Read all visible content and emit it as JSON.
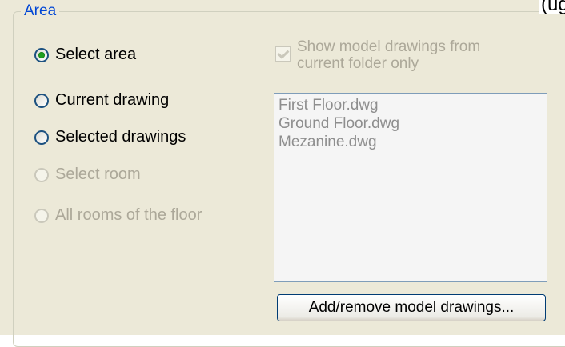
{
  "corner_text": "(ug",
  "area_group": {
    "legend": "Area",
    "radios": [
      {
        "label": "Select area",
        "checked": true,
        "enabled": true
      },
      {
        "label": "Current drawing",
        "checked": false,
        "enabled": true
      },
      {
        "label": "Selected drawings",
        "checked": false,
        "enabled": true
      },
      {
        "label": "Select room",
        "checked": false,
        "enabled": false
      },
      {
        "label": "All rooms of the floor",
        "checked": false,
        "enabled": false
      }
    ],
    "show_model_checkbox": {
      "label": "Show model drawings from current folder only",
      "checked": true,
      "enabled": false
    },
    "drawings_list": [
      "First Floor.dwg",
      "Ground Floor.dwg",
      "Mezanine.dwg"
    ],
    "add_remove_button": "Add/remove model drawings..."
  }
}
